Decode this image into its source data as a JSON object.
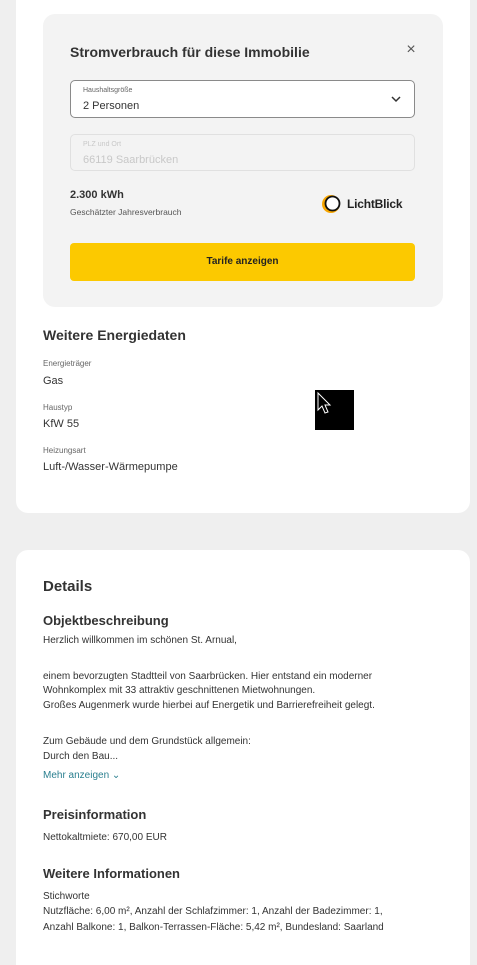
{
  "calculator": {
    "title": "Stromverbrauch für diese Immobilie",
    "close_glyph": "×",
    "household": {
      "label": "Haushaltsgröße",
      "value": "2 Personen"
    },
    "location": {
      "label": "PLZ und Ort",
      "value": "66119 Saarbrücken"
    },
    "consumption": {
      "value": "2.300 kWh",
      "label": "Geschätzter Jahresverbrauch"
    },
    "provider": "LichtBlick",
    "cta": "Tarife anzeigen"
  },
  "energy": {
    "title": "Weitere Energiedaten",
    "rows": [
      {
        "label": "Energieträger",
        "value": "Gas"
      },
      {
        "label": "Haustyp",
        "value": "KfW 55"
      },
      {
        "label": "Heizungsart",
        "value": "Luft-/Wasser-Wärmepumpe"
      }
    ]
  },
  "details": {
    "title": "Details",
    "description": {
      "title": "Objektbeschreibung",
      "lines": [
        "Herzlich willkommen im schönen St. Arnual,",
        "",
        "einem bevorzugten Stadtteil von Saarbrücken. Hier entstand ein moderner",
        "Wohnkomplex mit 33 attraktiv geschnittenen Mietwohnungen.",
        "Großes Augenmerk wurde hierbei auf Energetik und Barrierefreiheit gelegt.",
        "",
        "Zum Gebäude und dem Grundstück allgemein:",
        "Durch den Bau..."
      ],
      "more": "Mehr anzeigen ⌄"
    },
    "price": {
      "title": "Preisinformation",
      "text": "Nettokaltmiete: 670,00 EUR"
    },
    "info": {
      "title": "Weitere Informationen",
      "label": "Stichworte",
      "lines": [
        "Nutzfläche: 6,00 m², Anzahl der Schlafzimmer: 1, Anzahl der Badezimmer: 1,",
        "Anzahl Balkone: 1, Balkon-Terrassen-Fläche: 5,42 m², Bundesland: Saarland"
      ]
    }
  },
  "colors": {
    "accent": "#fcc900",
    "link": "#2a7f8f",
    "background": "#efefef"
  }
}
